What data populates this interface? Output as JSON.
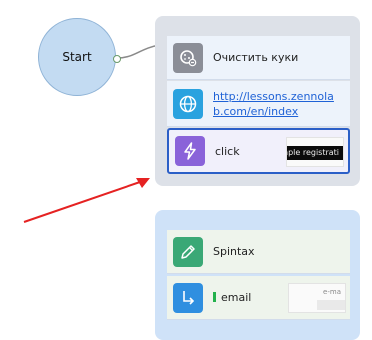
{
  "start_node": {
    "label": "Start"
  },
  "group_1": {
    "actions": [
      {
        "label": "Очистить куки",
        "icon": "cookie-clear-icon",
        "icon_color": "#8b8e97"
      },
      {
        "label": "http://lessons.zennolab.com/en/index",
        "label_line1": "http://lessons.zennola",
        "label_line2": "b.com/en/index",
        "icon": "globe-icon",
        "icon_color": "#2aa2df"
      },
      {
        "label": "click",
        "icon": "lightning-icon",
        "icon_color": "#8a63d9",
        "thumb_text": "nple registrati",
        "selected": true
      }
    ]
  },
  "group_2": {
    "actions": [
      {
        "label": "Spintax",
        "icon": "pencil-icon",
        "icon_color": "#3aa876"
      },
      {
        "label": "email",
        "icon": "arrow-down-right-icon",
        "icon_color": "#2f8fe0",
        "thumb_text": "e-ma"
      }
    ]
  },
  "colors": {
    "selection_border": "#2b5fc7",
    "arrow": "#e52222",
    "connector": "#8a8a8a"
  }
}
